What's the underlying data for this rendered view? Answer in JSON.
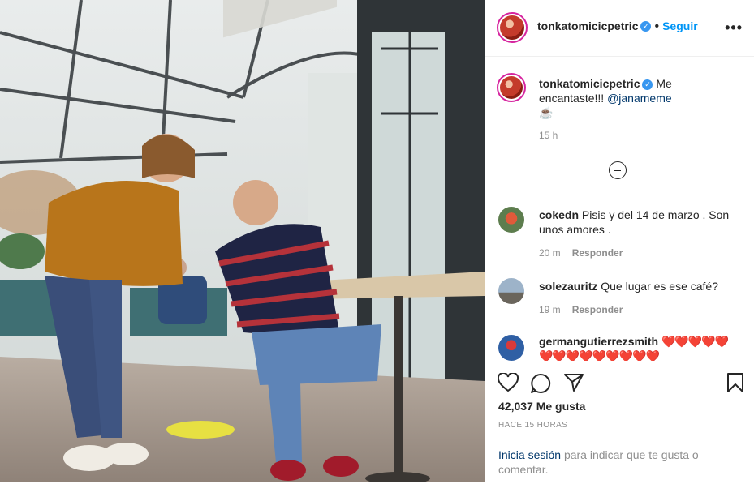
{
  "post": {
    "username": "tonkatomicicpetric",
    "follow_label": "Seguir",
    "separator": "•",
    "more_label": "•••"
  },
  "caption": {
    "username": "tonkatomicicpetric",
    "text": "Me encantaste!!!",
    "mention": "@janameme",
    "emoji": "☕",
    "time": "15 h"
  },
  "comments": [
    {
      "user": "cokedn",
      "text": "Pisis y del 14 de marzo . Son unos amores .",
      "time": "20 m",
      "reply": "Responder"
    },
    {
      "user": "solezauritz",
      "text": "Que lugar es ese café?",
      "time": "19 m",
      "reply": "Responder"
    },
    {
      "user": "germangutierrezsmith",
      "text": "❤️❤️❤️❤️❤️❤️❤️❤️❤️❤️❤️❤️❤️❤️",
      "time": "",
      "reply": ""
    }
  ],
  "actions": {
    "likes": "42,037 Me gusta",
    "posted": "HACE 15 HORAS",
    "login_link": "Inicia sesión",
    "login_text": "para indicar que te gusta o comentar."
  },
  "colors": {
    "link": "#0095f6",
    "mention": "#00376b",
    "heart": "#ed4956",
    "muted": "#8e8e8e"
  },
  "icons": [
    "verified-icon",
    "more-options-icon",
    "add-comments-icon",
    "heart-icon",
    "comment-icon",
    "share-icon",
    "bookmark-icon"
  ]
}
